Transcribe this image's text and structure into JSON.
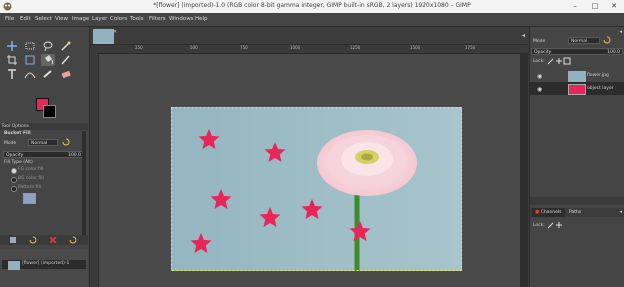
{
  "window": {
    "title": "*[flower] (imported)-1.0 (RGB color 8-bit gamma integer, GIMP built-in sRGB, 2 layers) 1920x1080 – GIMP",
    "minimize": "–",
    "maximize": "□",
    "close": "✕"
  },
  "menu": [
    "File",
    "Edit",
    "Select",
    "View",
    "Image",
    "Layer",
    "Colors",
    "Tools",
    "Filters",
    "Windows",
    "Help"
  ],
  "colors": {
    "foreground": "#e8265a",
    "background": "#000000",
    "accent_dark": "#2c2c2c"
  },
  "tool_options": {
    "header": "Tool Options",
    "tool_name": "Bucket Fill",
    "mode_label": "Mode",
    "mode_value": "Normal",
    "opacity_label": "Opacity",
    "opacity_value": "100.0",
    "fill_type_label": "Fill Type  (Alt)",
    "fill_options": [
      "FG color fill",
      "BG color fill",
      "Pattern fill"
    ],
    "selected_fill": 0
  },
  "images_panel": {
    "item_label": "[flower] (imported)-1"
  },
  "ruler": {
    "marks": [
      "250",
      "500",
      "750",
      "1000",
      "1250",
      "1500",
      "1750"
    ]
  },
  "layers_panel": {
    "mode_label": "Mode",
    "mode_value": "Normal",
    "opacity_label": "Opacity",
    "opacity_value": "100.0",
    "lock_label": "Lock:",
    "layers": [
      {
        "name": "flower.jpg",
        "selected": false
      },
      {
        "name": "object layer",
        "selected": true
      }
    ]
  },
  "bottom_tabs": {
    "tabs": [
      "Channels",
      "Paths"
    ],
    "lock_label": "Lock:"
  }
}
